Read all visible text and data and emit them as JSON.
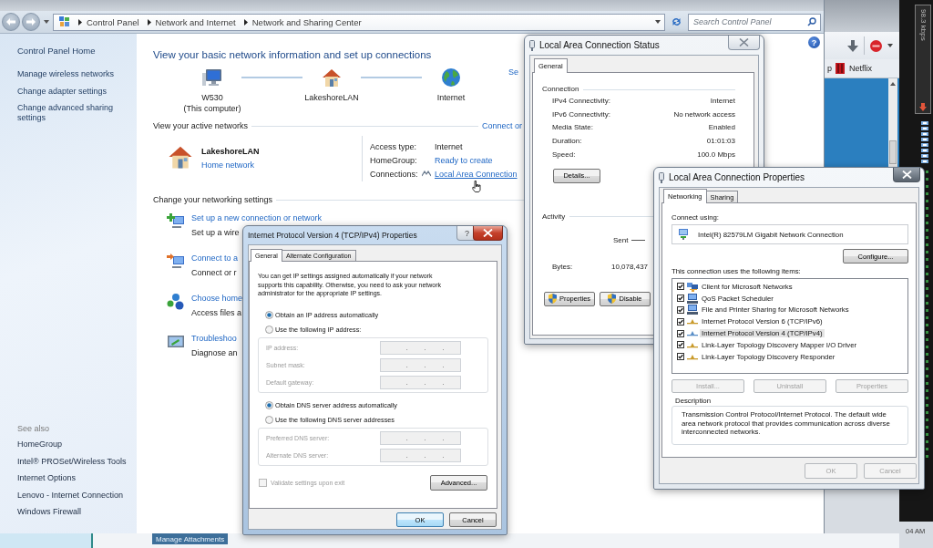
{
  "background": {
    "browser": {
      "bookmarks": [
        {
          "kind": "text",
          "label": "p"
        },
        {
          "kind": "netflix",
          "label": "Netflix"
        }
      ]
    },
    "meter": {
      "rate": "98.3 kbps"
    },
    "mail": {
      "button": "Manage Attachments"
    },
    "clock": {
      "time": "04 AM"
    }
  },
  "control_panel": {
    "breadcrumb": [
      "Control Panel",
      "Network and Internet",
      "Network and Sharing Center"
    ],
    "search": {
      "placeholder": "Search Control Panel"
    },
    "help": "?",
    "sidebar": {
      "home": "Control Panel Home",
      "links": [
        "Manage wireless networks",
        "Change adapter settings",
        "Change advanced sharing settings"
      ],
      "see_also": {
        "heading": "See also",
        "links": [
          "HomeGroup",
          "Intel® PROSet/Wireless Tools",
          "Internet Options",
          "Lenovo - Internet Connection",
          "Windows Firewall"
        ]
      }
    },
    "heading": "View your basic network information and set up connections",
    "network_map": {
      "nodes": [
        {
          "kind": "computer",
          "label": "W530",
          "sublabel": "(This computer)"
        },
        {
          "kind": "house",
          "label": "LakeshoreLAN"
        },
        {
          "kind": "globe",
          "label": "Internet"
        }
      ],
      "link": "Se"
    },
    "active_networks": {
      "heading": "View your active networks",
      "link": "Connect or",
      "network": {
        "name": "LakeshoreLAN",
        "type": "Home network"
      },
      "details": [
        {
          "kind": "text",
          "label": "Access type:",
          "value": "Internet"
        },
        {
          "kind": "link",
          "label": "HomeGroup:",
          "value": "Ready to create"
        },
        {
          "kind": "connection",
          "label": "Connections:",
          "value": "Local Area Connection"
        }
      ]
    },
    "settings": {
      "heading": "Change your networking settings",
      "tasks": [
        {
          "kind": "new-connection",
          "title": "Set up a new connection or network",
          "description": "Set up a wire"
        },
        {
          "kind": "connect",
          "title": "Connect to a",
          "description": "Connect or r"
        },
        {
          "kind": "homegroup",
          "title": "Choose home",
          "description": "Access files a"
        },
        {
          "kind": "troubleshoot",
          "title": "Troubleshoo",
          "description": "Diagnose an"
        }
      ]
    }
  },
  "status_dialog": {
    "title": "Local Area Connection Status",
    "tabs": [
      {
        "label": "General",
        "selected": true
      }
    ],
    "connection": {
      "heading": "Connection",
      "rows": [
        {
          "label": "IPv4 Connectivity:",
          "value": "Internet"
        },
        {
          "label": "IPv6 Connectivity:",
          "value": "No network access"
        },
        {
          "label": "Media State:",
          "value": "Enabled"
        },
        {
          "label": "Duration:",
          "value": "01:01:03"
        },
        {
          "label": "Speed:",
          "value": "100.0 Mbps"
        }
      ]
    },
    "details_button": "Details...",
    "activity": {
      "heading": "Activity",
      "sent_label": "Sent",
      "bytes_label": "Bytes:",
      "bytes_sent": "10,078,437"
    },
    "buttons": [
      "Properties",
      "Disable"
    ]
  },
  "properties_dialog": {
    "title": "Local Area Connection Properties",
    "tabs": [
      {
        "label": "Networking",
        "selected": true
      },
      {
        "label": "Sharing",
        "selected": false
      }
    ],
    "connect_using": {
      "label": "Connect using:",
      "adapter": "Intel(R) 82579LM Gigabit Network Connection"
    },
    "configure_button": "Configure...",
    "items_label": "This connection uses the following items:",
    "items": [
      {
        "kind": "client",
        "label": "Client for Microsoft Networks",
        "checked": true,
        "selected": false
      },
      {
        "kind": "service",
        "label": "QoS Packet Scheduler",
        "checked": true,
        "selected": false
      },
      {
        "kind": "service",
        "label": "File and Printer Sharing for Microsoft Networks",
        "checked": true,
        "selected": false
      },
      {
        "kind": "protocol",
        "label": "Internet Protocol Version 6 (TCP/IPv6)",
        "checked": true,
        "selected": false
      },
      {
        "kind": "protocol",
        "label": "Internet Protocol Version 4 (TCP/IPv4)",
        "checked": true,
        "selected": true
      },
      {
        "kind": "protocol",
        "label": "Link-Layer Topology Discovery Mapper I/O Driver",
        "checked": true,
        "selected": false
      },
      {
        "kind": "protocol",
        "label": "Link-Layer Topology Discovery Responder",
        "checked": true,
        "selected": false
      }
    ],
    "item_buttons": [
      {
        "label": "Install...",
        "disabled": true
      },
      {
        "label": "Uninstall",
        "disabled": true
      },
      {
        "label": "Properties",
        "disabled": true
      }
    ],
    "description": {
      "heading": "Description",
      "text": "Transmission Control Protocol/Internet Protocol. The default wide area network protocol that provides communication across diverse interconnected networks."
    },
    "footer_buttons": [
      {
        "label": "OK",
        "disabled": true
      },
      {
        "label": "Cancel",
        "disabled": true
      }
    ]
  },
  "ipv4_dialog": {
    "title": "Internet Protocol Version 4 (TCP/IPv4) Properties",
    "help": "?",
    "tabs": [
      {
        "label": "General",
        "selected": true
      },
      {
        "label": "Alternate Configuration",
        "selected": false
      }
    ],
    "intro": "You can get IP settings assigned automatically if your network supports this capability. Otherwise, you need to ask your network administrator for the appropriate IP settings.",
    "ip_mode": [
      {
        "label": "Obtain an IP address automatically",
        "selected": true
      },
      {
        "label": "Use the following IP address:",
        "selected": false
      }
    ],
    "ip_fields": [
      {
        "label": "IP address:",
        "value": ". . .",
        "disabled": true
      },
      {
        "label": "Subnet mask:",
        "value": ". . .",
        "disabled": true
      },
      {
        "label": "Default gateway:",
        "value": ". . .",
        "disabled": true
      }
    ],
    "dns_mode": [
      {
        "label": "Obtain DNS server address automatically",
        "selected": true
      },
      {
        "label": "Use the following DNS server addresses",
        "selected": false
      }
    ],
    "dns_fields": [
      {
        "label": "Preferred DNS server:",
        "value": ". . .",
        "disabled": true
      },
      {
        "label": "Alternate DNS server:",
        "value": ". . .",
        "disabled": true
      }
    ],
    "validate": {
      "label": "Validate settings upon exit",
      "checked": false,
      "disabled": true
    },
    "advanced_button": "Advanced...",
    "buttons": [
      {
        "label": "OK",
        "focused": true
      },
      {
        "label": "Cancel",
        "focused": false
      }
    ]
  }
}
